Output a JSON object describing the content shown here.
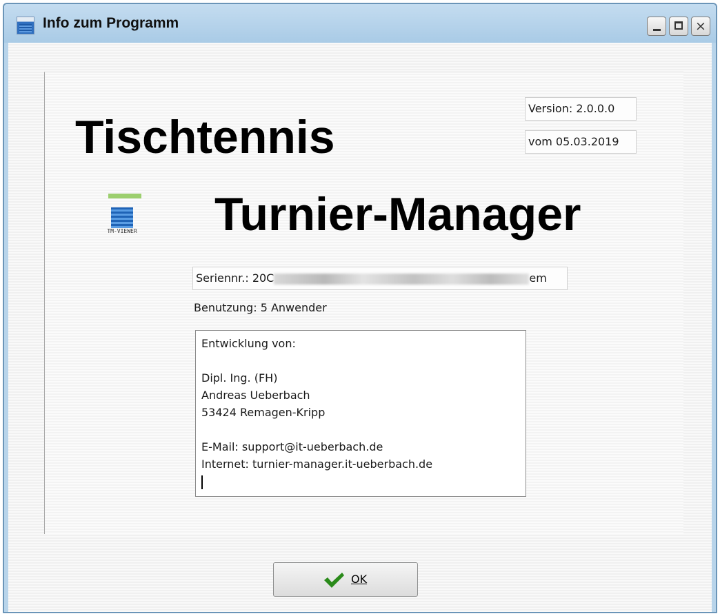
{
  "window": {
    "title": "Info zum Programm",
    "icon": "app-icon"
  },
  "titlebar_buttons": {
    "minimize_icon": "minimize-icon",
    "maximize_icon": "maximize-icon",
    "close_icon": "close-icon",
    "close_glyph": "×"
  },
  "about": {
    "version": "Version: 2.0.0.0",
    "date": "vom 05.03.2019",
    "title_line1": "Tischtennis",
    "title_line2": "Turnier-Manager",
    "logo_caption": "TM-VIEWER",
    "serial_prefix": "Seriennr.: 20C",
    "serial_suffix": "em",
    "usage": "Benutzung: 5 Anwender",
    "credits": {
      "line1": "Entwicklung von:",
      "line2": "",
      "line3": "Dipl. Ing. (FH)",
      "line4": "Andreas Ueberbach",
      "line5": "53424 Remagen-Kripp",
      "line6": "",
      "line7": "E-Mail: support@it-ueberbach.de",
      "line8": "Internet: turnier-manager.it-ueberbach.de"
    }
  },
  "buttons": {
    "ok_label": "OK",
    "ok_icon": "checkmark-icon",
    "ok_icon_color": "#2a8a1a"
  }
}
